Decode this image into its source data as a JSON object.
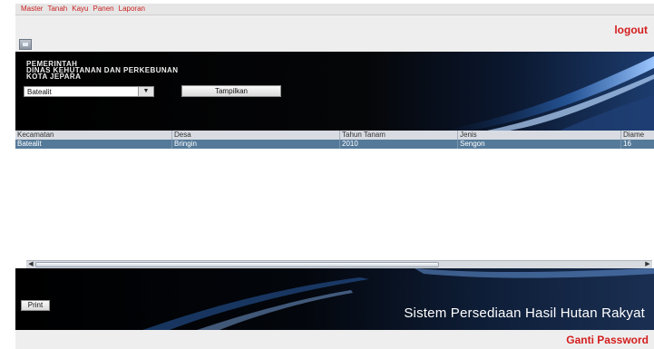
{
  "menubar": {
    "items": [
      "Master",
      "Tanah",
      "Kayu",
      "Panen",
      "Laporan"
    ]
  },
  "logout_label": "logout",
  "header": {
    "lines": [
      "PEMERINTAH",
      "DINAS KEHUTANAN DAN PERKEBUNAN",
      "KOTA JEPARA"
    ]
  },
  "filter": {
    "combo_value": "Batealit",
    "show_button_label": "Tampilkan"
  },
  "table": {
    "columns": [
      "Kecamatan",
      "Desa",
      "Tahun Tanam",
      "Jenis",
      "Diame"
    ],
    "rows": [
      [
        "Batealit",
        "Bringin",
        "2010",
        "Sengon",
        "16"
      ]
    ]
  },
  "print_label": "Print",
  "footer_title": "Sistem Persediaan Hasil Hutan Rakyat",
  "change_password_label": "Ganti Password",
  "colors": {
    "accent_red": "#d41e1e",
    "selected_row": "#557a99",
    "banner_dark": "#000000"
  },
  "icons": {
    "toolbar": "window-icon",
    "combo_arrow": "chevron-down-icon",
    "scroll_left": "arrow-left-icon",
    "scroll_right": "arrow-right-icon"
  }
}
